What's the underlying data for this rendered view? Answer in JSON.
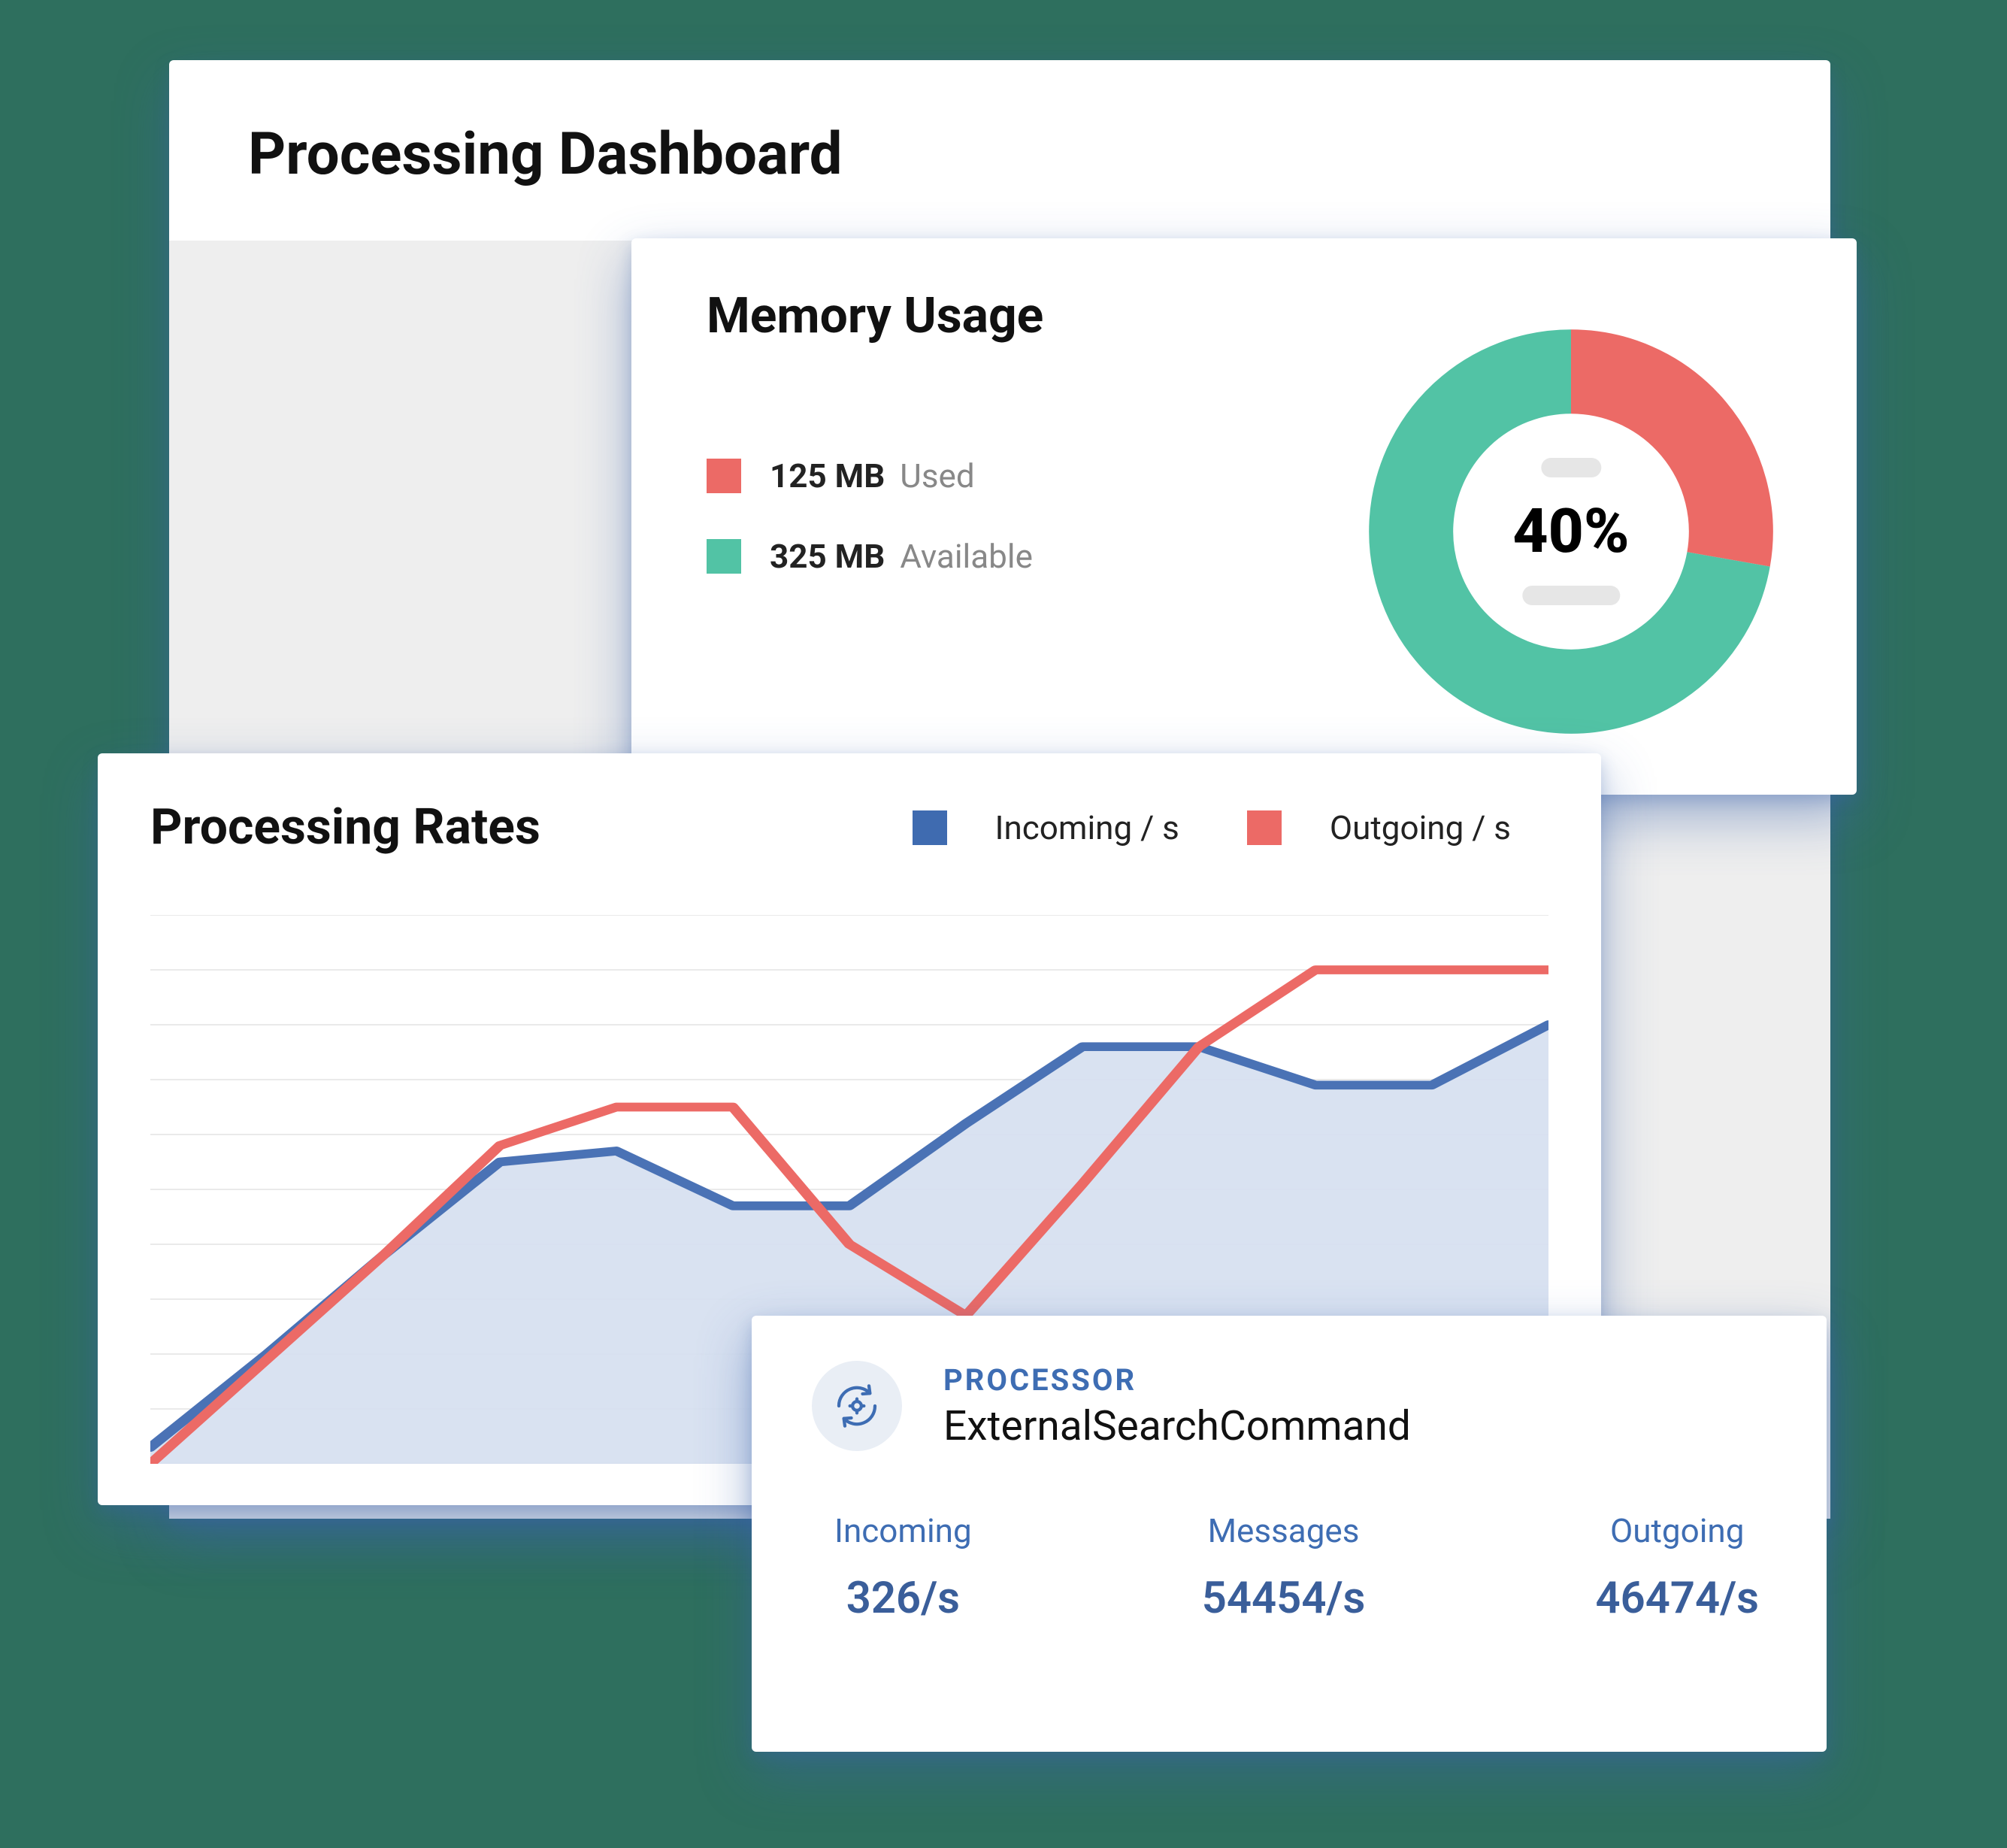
{
  "colors": {
    "red": "#ec6a66",
    "teal": "#52c3a5",
    "blue": "#3f6bb0",
    "blueLine": "#4a72b5",
    "blueFill": "#d5dfef"
  },
  "dashboard": {
    "title": "Processing Dashboard"
  },
  "memory": {
    "title": "Memory Usage",
    "used": {
      "value": "125 MB",
      "label": "Used"
    },
    "available": {
      "value": "325 MB",
      "label": "Available"
    },
    "percent_label": "40%"
  },
  "rates": {
    "title": "Processing Rates",
    "legend": {
      "incoming": "Incoming / s",
      "outgoing": "Outgoing / s"
    }
  },
  "processor": {
    "heading": "PROCESSOR",
    "name": "ExternalSearchCommand",
    "stats": {
      "incoming": {
        "label": "Incoming",
        "value": "326/s"
      },
      "messages": {
        "label": "Messages",
        "value": "54454/s"
      },
      "outgoing": {
        "label": "Outgoing",
        "value": "46474/s"
      }
    }
  },
  "chart_data": [
    {
      "type": "pie",
      "title": "Memory Usage",
      "series": [
        {
          "name": "Used",
          "values": [
            125
          ],
          "color": "#ec6a66"
        },
        {
          "name": "Available",
          "values": [
            325
          ],
          "color": "#52c3a5"
        }
      ],
      "center_label": "40%",
      "donut": true
    },
    {
      "type": "line",
      "title": "Processing Rates",
      "x": [
        0,
        1,
        2,
        3,
        4,
        5,
        6,
        7,
        8,
        9,
        10,
        11,
        12
      ],
      "xlabel": "",
      "ylabel": "",
      "ylim": [
        0,
        10
      ],
      "grid": true,
      "series": [
        {
          "name": "Incoming / s",
          "color": "#4a72b5",
          "values": [
            0.3,
            2.0,
            3.8,
            5.5,
            5.7,
            4.7,
            4.7,
            6.2,
            7.6,
            7.6,
            6.9,
            6.9,
            8.0
          ]
        },
        {
          "name": "Outgoing / s",
          "color": "#ec6a66",
          "values": [
            0.0,
            1.9,
            3.8,
            5.8,
            6.5,
            6.5,
            4.0,
            2.7,
            5.1,
            7.6,
            9.0,
            9.0,
            9.0
          ]
        }
      ]
    }
  ]
}
